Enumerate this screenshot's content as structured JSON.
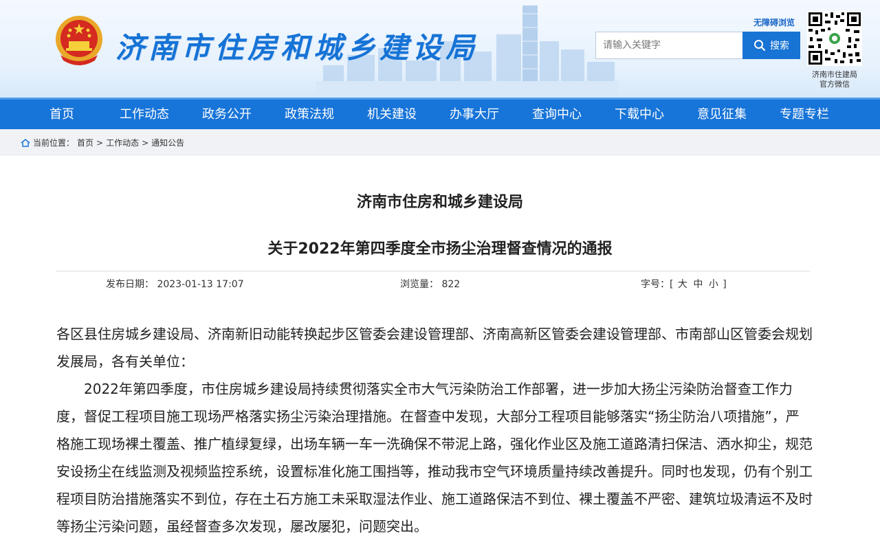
{
  "header": {
    "site_title": "济南市住房和城乡建设局",
    "accessibility_link": "无障碍浏览",
    "search": {
      "placeholder": "请输入关键字",
      "button_label": "搜索"
    },
    "qr_caption_line1": "济南市住建局",
    "qr_caption_line2": "官方微信"
  },
  "nav": {
    "items": [
      "首页",
      "工作动态",
      "政务公开",
      "政策法规",
      "机关建设",
      "办事大厅",
      "查询中心",
      "下载中心",
      "意见征集",
      "专题专栏"
    ]
  },
  "breadcrumb": {
    "prefix": "当前位置：",
    "items": [
      "首页",
      "工作动态",
      "通知公告"
    ],
    "separator": ">"
  },
  "article": {
    "org": "济南市住房和城乡建设局",
    "title": "关于2022年第四季度全市扬尘治理督查情况的通报",
    "meta": {
      "date_label": "发布日期：",
      "date_value": "2023-01-13 17:07",
      "views_label": "浏览量：",
      "views_value": "822",
      "font_label": "字号：",
      "font_open": "[",
      "font_large": "大",
      "font_medium": "中",
      "font_small": "小",
      "font_close": "]"
    },
    "paragraphs": [
      "各区县住房城乡建设局、济南新旧动能转换起步区管委会建设管理部、济南高新区管委会建设管理部、市南部山区管委会规划发展局，各有关单位：",
      "2022年第四季度，市住房城乡建设局持续贯彻落实全市大气污染防治工作部署，进一步加大扬尘污染防治督查工作力度，督促工程项目施工现场严格落实扬尘污染治理措施。在督查中发现，大部分工程项目能够落实“扬尘防治八项措施”，严格施工现场裸土覆盖、推广植绿复绿，出场车辆一车一洗确保不带泥上路，强化作业区及施工道路清扫保洁、洒水抑尘，规范安设扬尘在线监测及视频监控系统，设置标准化施工围挡等，推动我市空气环境质量持续改善提升。同时也发现，仍有个别工程项目防治措施落实不到位，存在土石方施工未采取湿法作业、施工道路保洁不到位、裸土覆盖不严密、建筑垃圾清运不及时等扬尘污染问题，虽经督查多次发现，屡改屡犯，问题突出。"
    ]
  },
  "colors": {
    "primary": "#1774d8",
    "title_blue": "#1673d6",
    "breadcrumb_bg": "#f0f2f5"
  }
}
